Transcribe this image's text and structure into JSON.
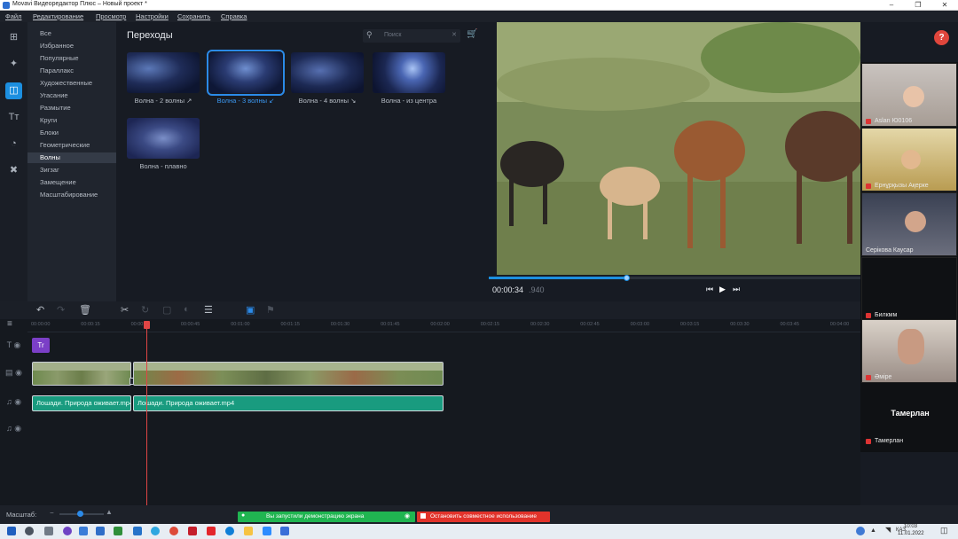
{
  "window": {
    "title": "Movavi Видеоредактор Плюс – Новый проект *"
  },
  "menu": [
    "Файл",
    "Редактирование",
    "Просмотр",
    "Настройки",
    "Сохранить",
    "Справка"
  ],
  "categories": [
    "Все",
    "Избранное",
    "Популярные",
    "Параллакс",
    "Художественные",
    "Угасание",
    "Размытие",
    "Круги",
    "Блоки",
    "Геометрические",
    "Волны",
    "Зигзаг",
    "Замещение",
    "Масштабирование"
  ],
  "selected_category": "Волны",
  "transitions": {
    "title": "Переходы",
    "search_placeholder": "Поиск",
    "items": [
      "Волна - 2 волны ↗",
      "Волна - 3 волны ↙",
      "Волна - 4 волны ↘",
      "Волна - из центра",
      "Волна - плавно"
    ],
    "selected": 1
  },
  "preview": {
    "time_main": "00:00:34",
    "time_ms": ".940",
    "progress": 0.37
  },
  "participants": [
    "Aslan Ю0106",
    "Ернұрқызы Ақерке",
    "Серікова Каусар",
    "Билкмм",
    "Әміре",
    "Тамерлан"
  ],
  "participant_big": "Тамерлан",
  "timeline": {
    "ticks": [
      "00:00:00",
      "00:00:15",
      "00:00:30",
      "00:00:45",
      "00:01:00",
      "00:01:15",
      "00:01:30",
      "00:01:45",
      "00:02:00",
      "00:02:15",
      "00:02:30",
      "00:02:45",
      "00:03:00",
      "00:03:15",
      "00:03:30",
      "00:03:45",
      "00:04:00"
    ],
    "title_clip": "Tr",
    "audio_clip_1": "Лошади. Природа оживает.mp4",
    "audio_clip_2": "Лошади. Природа оживает.mp4"
  },
  "footer": {
    "scale_label": "Масштаб:",
    "share_text": "Вы запустили демонстрацию экрана",
    "stop_text": "Остановить совместное использование"
  },
  "taskbar": {
    "lang": "КАЗ",
    "time": "10:03",
    "date": "11.01.2022"
  },
  "colors": {
    "accent": "#1c8fe0",
    "share_green": "#20b551",
    "stop_red": "#e2332b",
    "playhead": "#e04545",
    "clip_teal": "#199b7f",
    "title_purple": "#7b3fc7"
  }
}
